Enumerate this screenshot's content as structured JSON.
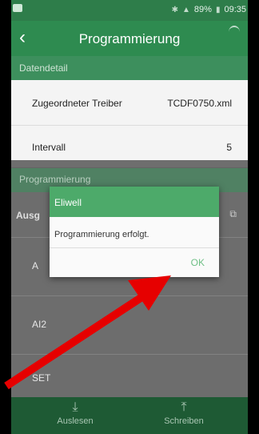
{
  "status_bar": {
    "battery": "89%",
    "time": "09:35"
  },
  "header": {
    "title": "Programmierung"
  },
  "sections": {
    "datendetail": "Datendetail",
    "programmierung": "Programmierung"
  },
  "fields": [
    {
      "label": "Zugeordneter Treiber",
      "value": "TCDF0750.xml"
    },
    {
      "label": "Intervall",
      "value": "5"
    }
  ],
  "list_items": [
    "Ausg",
    "A",
    "AI2",
    "SET"
  ],
  "dialog": {
    "title": "Eliwell",
    "message": "Programmierung erfolgt.",
    "ok_label": "OK"
  },
  "bottom_nav": [
    {
      "label": "Auslesen",
      "icon": "download-icon"
    },
    {
      "label": "Schreiben",
      "icon": "upload-icon"
    }
  ],
  "colors": {
    "primary": "#2e8b50",
    "dialog_title": "#4daa6a",
    "arrow": "#e60000"
  }
}
